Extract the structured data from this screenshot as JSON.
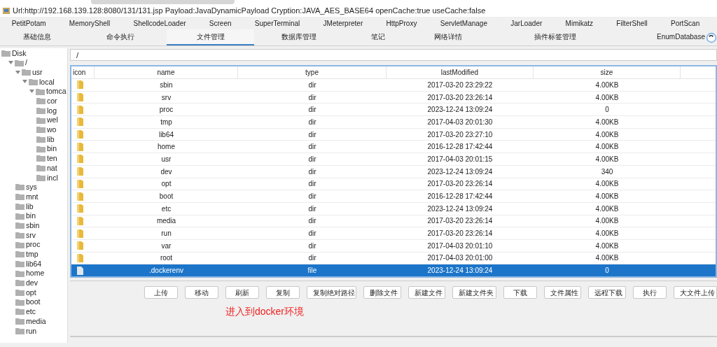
{
  "window": {
    "title": "Url:http://192.168.139.128:8080/131/131.jsp Payload:JavaDynamicPayload Cryption:JAVA_AES_BASE64 openCache:true useCache:false"
  },
  "plugin_tabs": [
    "PetitPotam",
    "MemoryShell",
    "ShellcodeLoader",
    "Screen",
    "SuperTerminal",
    "JMeterpreter",
    "HttpProxy",
    "ServletManage",
    "JarLoader",
    "Mimikatz",
    "FilterShell",
    "PortScan"
  ],
  "tabs": [
    {
      "label": "基础信息",
      "selected": false
    },
    {
      "label": "命令执行",
      "selected": false
    },
    {
      "label": "文件管理",
      "selected": true
    },
    {
      "label": "数据库管理",
      "selected": false
    },
    {
      "label": "笔记",
      "selected": false
    },
    {
      "label": "网络详情",
      "selected": false
    },
    {
      "label": "插件标签管理",
      "selected": false
    },
    {
      "label": "EnumDatabase",
      "selected": false
    }
  ],
  "tree": {
    "label": "Disk",
    "children": [
      {
        "label": "/",
        "expanded": true,
        "children": [
          {
            "label": "usr",
            "expanded": true,
            "children": [
              {
                "label": "local",
                "expanded": true,
                "children": [
                  {
                    "label": "tomca",
                    "expanded": true,
                    "children": [
                      {
                        "label": "cor"
                      },
                      {
                        "label": "log"
                      },
                      {
                        "label": "wel"
                      },
                      {
                        "label": "wo"
                      },
                      {
                        "label": "lib"
                      },
                      {
                        "label": "bin"
                      },
                      {
                        "label": "ten"
                      },
                      {
                        "label": "nat"
                      },
                      {
                        "label": "incl"
                      }
                    ]
                  }
                ]
              }
            ]
          },
          {
            "label": "sys"
          },
          {
            "label": "mnt"
          },
          {
            "label": "lib"
          },
          {
            "label": "bin"
          },
          {
            "label": "sbin"
          },
          {
            "label": "srv"
          },
          {
            "label": "proc"
          },
          {
            "label": "tmp"
          },
          {
            "label": "lib64"
          },
          {
            "label": "home"
          },
          {
            "label": "dev"
          },
          {
            "label": "opt"
          },
          {
            "label": "boot"
          },
          {
            "label": "etc"
          },
          {
            "label": "media"
          },
          {
            "label": "run"
          }
        ]
      }
    ]
  },
  "path_field": {
    "value": "/"
  },
  "table": {
    "columns": [
      "icon",
      "name",
      "type",
      "lastModified",
      "size"
    ],
    "rows": [
      {
        "kind": "dir",
        "name": "sbin",
        "type": "dir",
        "lastModified": "2017-03-20 23:29:22",
        "size": "4.00KB",
        "selected": false
      },
      {
        "kind": "dir",
        "name": "srv",
        "type": "dir",
        "lastModified": "2017-03-20 23:26:14",
        "size": "4.00KB",
        "selected": false
      },
      {
        "kind": "dir",
        "name": "proc",
        "type": "dir",
        "lastModified": "2023-12-24 13:09:24",
        "size": "0",
        "selected": false
      },
      {
        "kind": "dir",
        "name": "tmp",
        "type": "dir",
        "lastModified": "2017-04-03 20:01:30",
        "size": "4.00KB",
        "selected": false
      },
      {
        "kind": "dir",
        "name": "lib64",
        "type": "dir",
        "lastModified": "2017-03-20 23:27:10",
        "size": "4.00KB",
        "selected": false
      },
      {
        "kind": "dir",
        "name": "home",
        "type": "dir",
        "lastModified": "2016-12-28 17:42:44",
        "size": "4.00KB",
        "selected": false
      },
      {
        "kind": "dir",
        "name": "usr",
        "type": "dir",
        "lastModified": "2017-04-03 20:01:15",
        "size": "4.00KB",
        "selected": false
      },
      {
        "kind": "dir",
        "name": "dev",
        "type": "dir",
        "lastModified": "2023-12-24 13:09:24",
        "size": "340",
        "selected": false
      },
      {
        "kind": "dir",
        "name": "opt",
        "type": "dir",
        "lastModified": "2017-03-20 23:26:14",
        "size": "4.00KB",
        "selected": false
      },
      {
        "kind": "dir",
        "name": "boot",
        "type": "dir",
        "lastModified": "2016-12-28 17:42:44",
        "size": "4.00KB",
        "selected": false
      },
      {
        "kind": "dir",
        "name": "etc",
        "type": "dir",
        "lastModified": "2023-12-24 13:09:24",
        "size": "4.00KB",
        "selected": false
      },
      {
        "kind": "dir",
        "name": "media",
        "type": "dir",
        "lastModified": "2017-03-20 23:26:14",
        "size": "4.00KB",
        "selected": false
      },
      {
        "kind": "dir",
        "name": "run",
        "type": "dir",
        "lastModified": "2017-03-20 23:26:14",
        "size": "4.00KB",
        "selected": false
      },
      {
        "kind": "dir",
        "name": "var",
        "type": "dir",
        "lastModified": "2017-04-03 20:01:10",
        "size": "4.00KB",
        "selected": false
      },
      {
        "kind": "dir",
        "name": "root",
        "type": "dir",
        "lastModified": "2017-04-03 20:01:00",
        "size": "4.00KB",
        "selected": false
      },
      {
        "kind": "file",
        "name": ".dockerenv",
        "type": "file",
        "lastModified": "2023-12-24 13:09:24",
        "size": "0",
        "selected": true
      }
    ]
  },
  "buttons": [
    "上传",
    "移动",
    "刷新",
    "复制",
    "复制绝对路径",
    "删除文件",
    "新建文件",
    "新建文件夹",
    "下载",
    "文件属性",
    "远程下载",
    "执行",
    "大文件上传"
  ],
  "annotation": "进入到docker环境"
}
